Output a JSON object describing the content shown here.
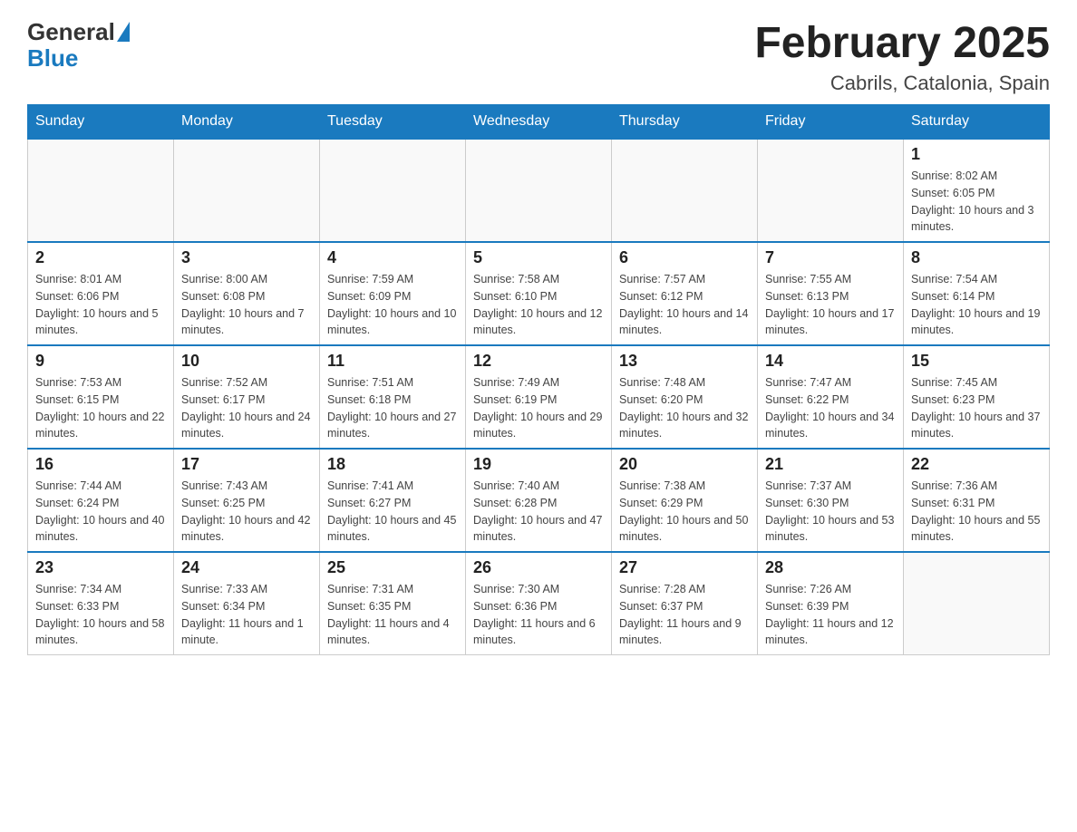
{
  "header": {
    "logo_general": "General",
    "logo_blue": "Blue",
    "month_title": "February 2025",
    "location": "Cabrils, Catalonia, Spain"
  },
  "weekdays": [
    "Sunday",
    "Monday",
    "Tuesday",
    "Wednesday",
    "Thursday",
    "Friday",
    "Saturday"
  ],
  "weeks": [
    [
      {
        "day": "",
        "info": ""
      },
      {
        "day": "",
        "info": ""
      },
      {
        "day": "",
        "info": ""
      },
      {
        "day": "",
        "info": ""
      },
      {
        "day": "",
        "info": ""
      },
      {
        "day": "",
        "info": ""
      },
      {
        "day": "1",
        "info": "Sunrise: 8:02 AM\nSunset: 6:05 PM\nDaylight: 10 hours and 3 minutes."
      }
    ],
    [
      {
        "day": "2",
        "info": "Sunrise: 8:01 AM\nSunset: 6:06 PM\nDaylight: 10 hours and 5 minutes."
      },
      {
        "day": "3",
        "info": "Sunrise: 8:00 AM\nSunset: 6:08 PM\nDaylight: 10 hours and 7 minutes."
      },
      {
        "day": "4",
        "info": "Sunrise: 7:59 AM\nSunset: 6:09 PM\nDaylight: 10 hours and 10 minutes."
      },
      {
        "day": "5",
        "info": "Sunrise: 7:58 AM\nSunset: 6:10 PM\nDaylight: 10 hours and 12 minutes."
      },
      {
        "day": "6",
        "info": "Sunrise: 7:57 AM\nSunset: 6:12 PM\nDaylight: 10 hours and 14 minutes."
      },
      {
        "day": "7",
        "info": "Sunrise: 7:55 AM\nSunset: 6:13 PM\nDaylight: 10 hours and 17 minutes."
      },
      {
        "day": "8",
        "info": "Sunrise: 7:54 AM\nSunset: 6:14 PM\nDaylight: 10 hours and 19 minutes."
      }
    ],
    [
      {
        "day": "9",
        "info": "Sunrise: 7:53 AM\nSunset: 6:15 PM\nDaylight: 10 hours and 22 minutes."
      },
      {
        "day": "10",
        "info": "Sunrise: 7:52 AM\nSunset: 6:17 PM\nDaylight: 10 hours and 24 minutes."
      },
      {
        "day": "11",
        "info": "Sunrise: 7:51 AM\nSunset: 6:18 PM\nDaylight: 10 hours and 27 minutes."
      },
      {
        "day": "12",
        "info": "Sunrise: 7:49 AM\nSunset: 6:19 PM\nDaylight: 10 hours and 29 minutes."
      },
      {
        "day": "13",
        "info": "Sunrise: 7:48 AM\nSunset: 6:20 PM\nDaylight: 10 hours and 32 minutes."
      },
      {
        "day": "14",
        "info": "Sunrise: 7:47 AM\nSunset: 6:22 PM\nDaylight: 10 hours and 34 minutes."
      },
      {
        "day": "15",
        "info": "Sunrise: 7:45 AM\nSunset: 6:23 PM\nDaylight: 10 hours and 37 minutes."
      }
    ],
    [
      {
        "day": "16",
        "info": "Sunrise: 7:44 AM\nSunset: 6:24 PM\nDaylight: 10 hours and 40 minutes."
      },
      {
        "day": "17",
        "info": "Sunrise: 7:43 AM\nSunset: 6:25 PM\nDaylight: 10 hours and 42 minutes."
      },
      {
        "day": "18",
        "info": "Sunrise: 7:41 AM\nSunset: 6:27 PM\nDaylight: 10 hours and 45 minutes."
      },
      {
        "day": "19",
        "info": "Sunrise: 7:40 AM\nSunset: 6:28 PM\nDaylight: 10 hours and 47 minutes."
      },
      {
        "day": "20",
        "info": "Sunrise: 7:38 AM\nSunset: 6:29 PM\nDaylight: 10 hours and 50 minutes."
      },
      {
        "day": "21",
        "info": "Sunrise: 7:37 AM\nSunset: 6:30 PM\nDaylight: 10 hours and 53 minutes."
      },
      {
        "day": "22",
        "info": "Sunrise: 7:36 AM\nSunset: 6:31 PM\nDaylight: 10 hours and 55 minutes."
      }
    ],
    [
      {
        "day": "23",
        "info": "Sunrise: 7:34 AM\nSunset: 6:33 PM\nDaylight: 10 hours and 58 minutes."
      },
      {
        "day": "24",
        "info": "Sunrise: 7:33 AM\nSunset: 6:34 PM\nDaylight: 11 hours and 1 minute."
      },
      {
        "day": "25",
        "info": "Sunrise: 7:31 AM\nSunset: 6:35 PM\nDaylight: 11 hours and 4 minutes."
      },
      {
        "day": "26",
        "info": "Sunrise: 7:30 AM\nSunset: 6:36 PM\nDaylight: 11 hours and 6 minutes."
      },
      {
        "day": "27",
        "info": "Sunrise: 7:28 AM\nSunset: 6:37 PM\nDaylight: 11 hours and 9 minutes."
      },
      {
        "day": "28",
        "info": "Sunrise: 7:26 AM\nSunset: 6:39 PM\nDaylight: 11 hours and 12 minutes."
      },
      {
        "day": "",
        "info": ""
      }
    ]
  ]
}
